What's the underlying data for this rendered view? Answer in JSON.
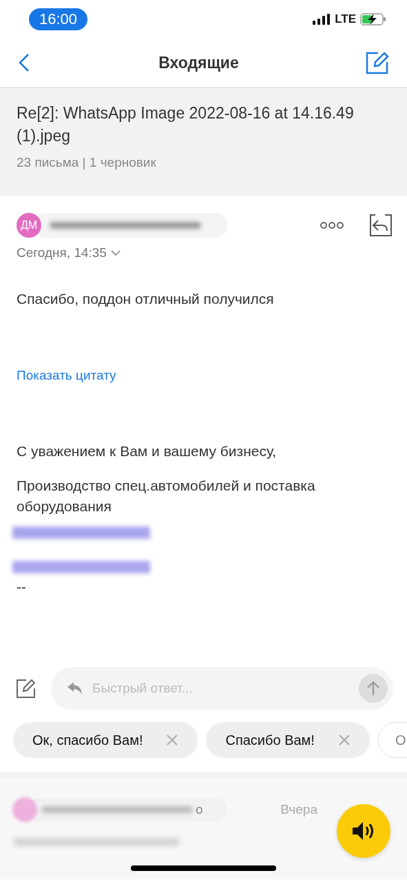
{
  "status_bar": {
    "time": "16:00",
    "network": "LTE"
  },
  "nav": {
    "title": "Входящие"
  },
  "thread": {
    "subject": "Re[2]: WhatsApp Image 2022-08-16 at 14.16.49 (1).jpeg",
    "meta": "23 письма | 1 черновик"
  },
  "message": {
    "avatar_initials": "ДМ",
    "date": "Сегодня, 14:35",
    "body": "Спасибо, поддон отличный получился",
    "quote_link": "Показать цитату",
    "signature": [
      "С уважением к Вам и вашему бизнесу,",
      "Производство спец.автомобилей и поставка оборудования"
    ],
    "signature_end": "--"
  },
  "quick_reply": {
    "placeholder": "Быстрый ответ...",
    "chips": [
      {
        "label": "Ок, спасибо Вам!",
        "kind": "removable"
      },
      {
        "label": "Спасибо Вам!",
        "kind": "removable"
      },
      {
        "label": "О",
        "kind": "plain"
      }
    ]
  },
  "next_message": {
    "sender_tail": "о",
    "date": "Вчера"
  }
}
